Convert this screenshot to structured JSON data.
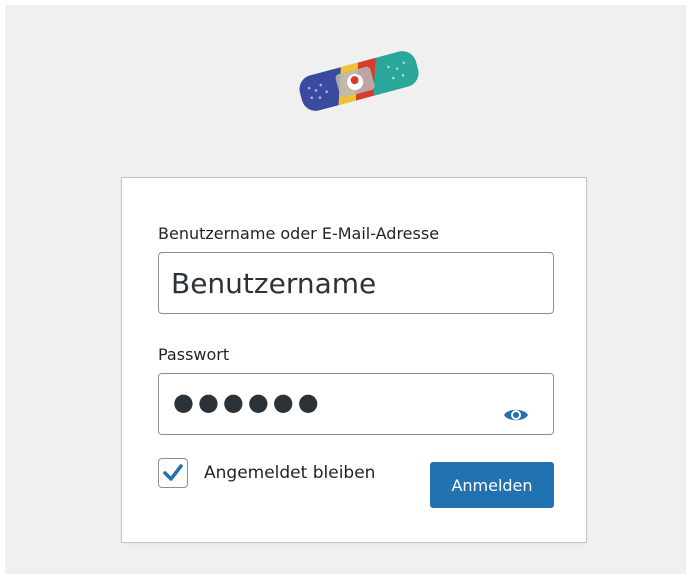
{
  "login_form": {
    "username_label": "Benutzername oder E-Mail-Adresse",
    "username_value": "Benutzername",
    "password_label": "Passwort",
    "password_masked": "●●●●●●",
    "remember_label": "Angemeldet bleiben",
    "remember_checked": true,
    "submit_label": "Anmelden"
  },
  "icons": {
    "logo": "bandage-logo-icon",
    "show_password": "eye-icon",
    "checkbox": "checkmark-icon"
  },
  "colors": {
    "accent": "#2271b1",
    "background": "#f0f0f1",
    "card": "#ffffff",
    "border": "#8c8f94"
  }
}
